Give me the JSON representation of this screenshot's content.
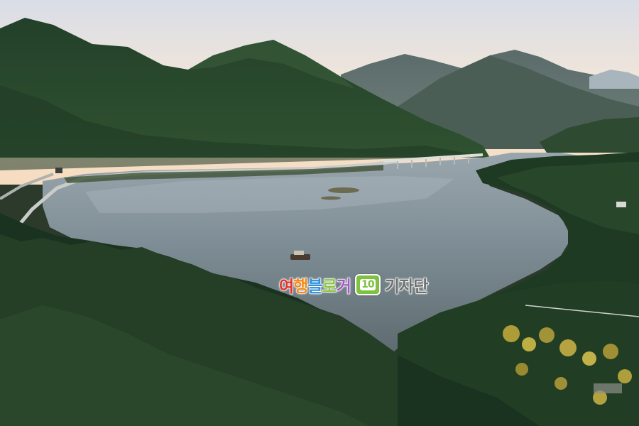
{
  "watermark": {
    "letters": [
      {
        "ch": "여",
        "color": "#e6332a"
      },
      {
        "ch": "행",
        "color": "#f08a1c"
      },
      {
        "ch": "블",
        "color": "#2f8fd8"
      },
      {
        "ch": "로",
        "color": "#8cc63f"
      },
      {
        "ch": "거",
        "color": "#a05cbf"
      }
    ],
    "badge": "10",
    "suffix": [
      "기",
      "자",
      "단"
    ]
  }
}
